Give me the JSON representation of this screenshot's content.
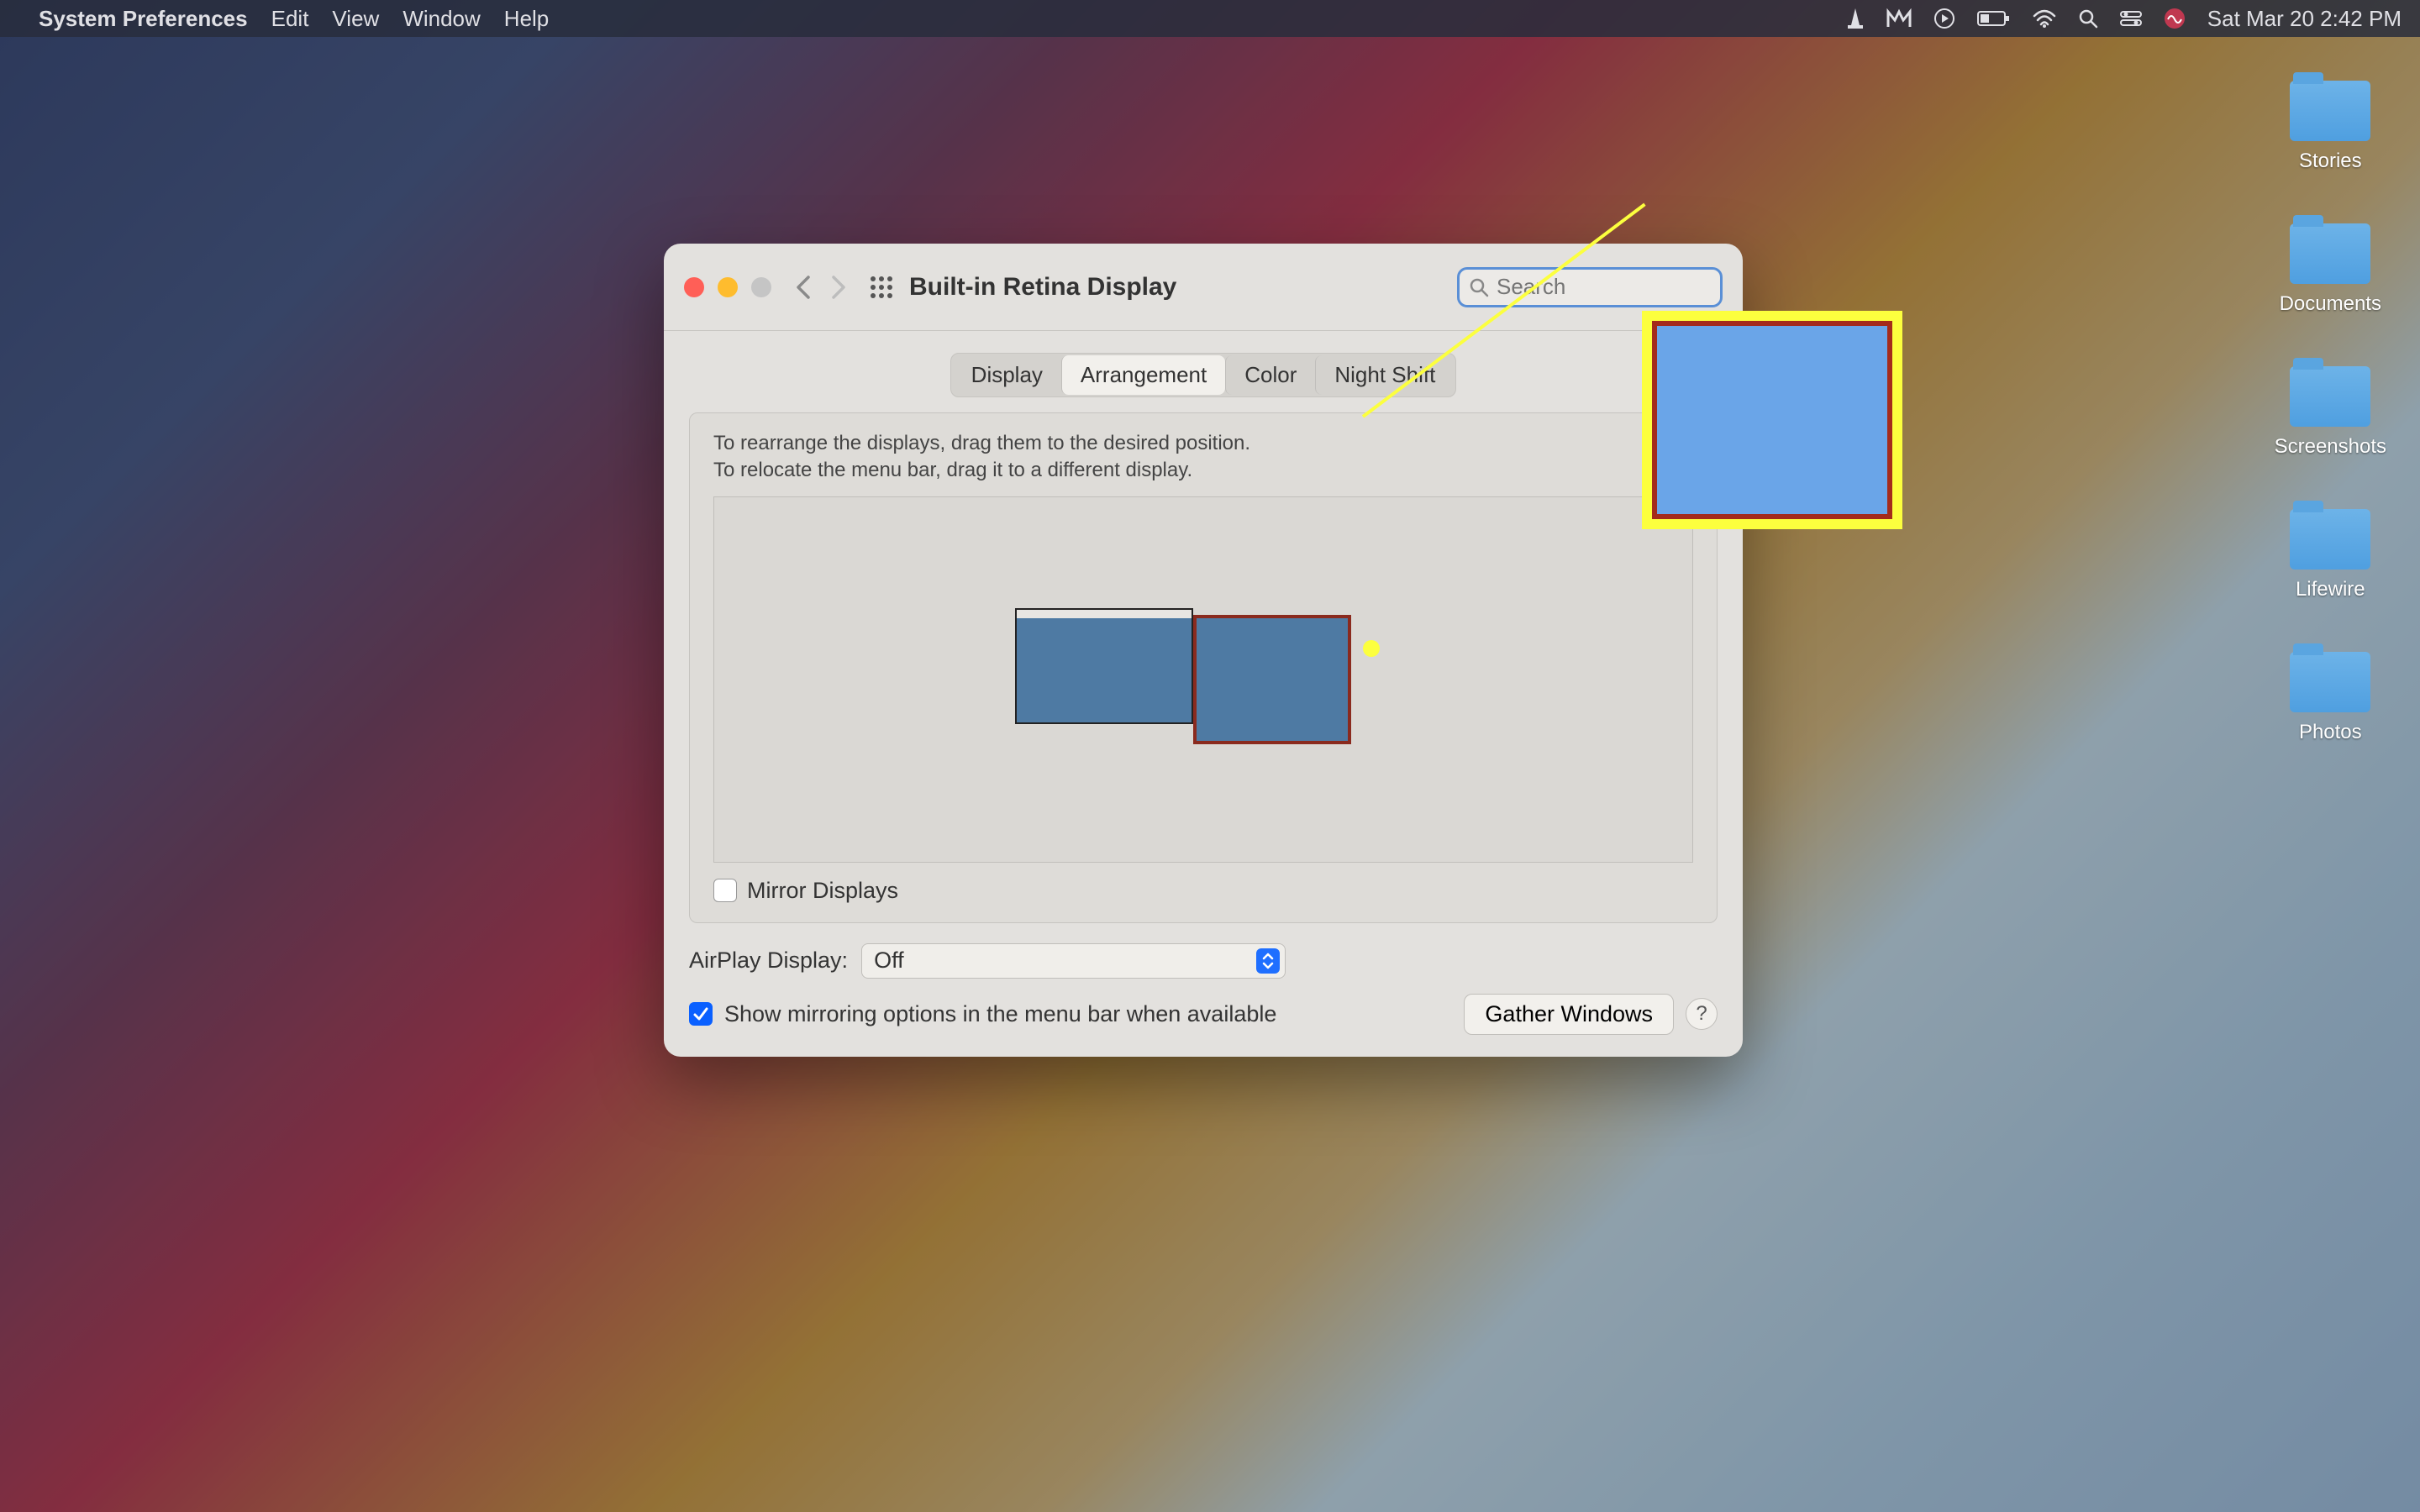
{
  "menubar": {
    "app_name": "System Preferences",
    "menus": [
      "Edit",
      "View",
      "Window",
      "Help"
    ],
    "clock": "Sat Mar 20  2:42 PM"
  },
  "desktop_folders": [
    "Stories",
    "Documents",
    "Screenshots",
    "Lifewire",
    "Photos"
  ],
  "window": {
    "title": "Built-in Retina Display",
    "search_placeholder": "Search",
    "tabs": [
      "Display",
      "Arrangement",
      "Color",
      "Night Shift"
    ],
    "active_tab": "Arrangement",
    "instructions_line1": "To rearrange the displays, drag them to the desired position.",
    "instructions_line2": "To relocate the menu bar, drag it to a different display.",
    "mirror_label": "Mirror Displays",
    "mirror_checked": false,
    "airplay_label": "AirPlay Display:",
    "airplay_value": "Off",
    "show_mirroring_label": "Show mirroring options in the menu bar when available",
    "show_mirroring_checked": true,
    "gather_button": "Gather Windows",
    "help_label": "?"
  }
}
